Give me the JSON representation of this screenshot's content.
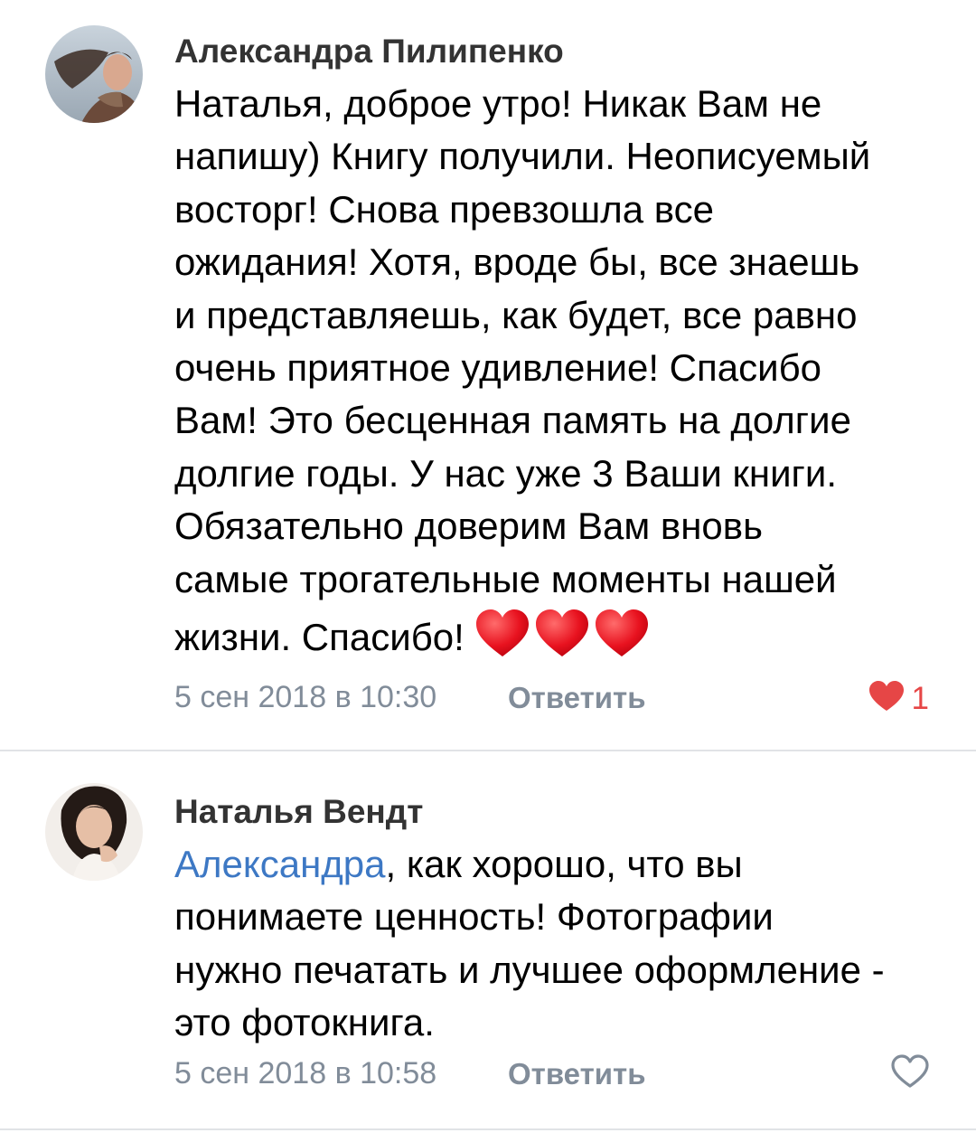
{
  "comments": [
    {
      "author": "Александра Пилипенко",
      "avatar_icon": "user-avatar-photo",
      "lines": [
        "Наталья, доброе утро! Никак Вам не",
        "напишу) Книгу получили. Неописуемый",
        "восторг! Снова превзошла все",
        "ожидания! Хотя, вроде бы, все знаешь",
        "и представляешь, как будет, все равно",
        "очень приятное удивление! Спасибо",
        "Вам! Это бесценная память на долгие",
        "долгие годы. У нас уже 3 Ваши книги.",
        "Обязательно доверим Вам вновь",
        "самые трогательные моменты нашей",
        "жизни. Спасибо! "
      ],
      "emoji": "❤️❤️❤️",
      "date": "5 сен 2018 в 10:30",
      "reply_label": "Ответить",
      "likes": "1",
      "liked": true
    },
    {
      "author": "Наталья Вендт",
      "avatar_icon": "user-avatar-photo",
      "mention": "Александра",
      "lines": [
        ", как хорошо, что вы",
        "понимаете ценность! Фотографии",
        "нужно печатать и лучшее оформление -",
        "это фотокнига."
      ],
      "date": "5 сен 2018 в 10:58",
      "reply_label": "Ответить",
      "liked": false
    }
  ],
  "colors": {
    "meta": "#818c99",
    "mention": "#3d78c4",
    "like_active": "#e64646",
    "divider": "#e1e3e6"
  }
}
